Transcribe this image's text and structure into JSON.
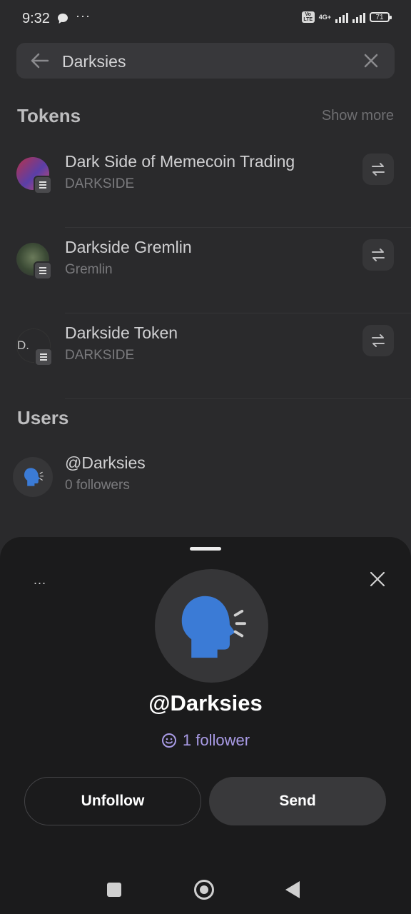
{
  "status_bar": {
    "time": "9:32",
    "network": "4G+",
    "volte": "Vo LTE",
    "battery": "71"
  },
  "search": {
    "value": "Darksies"
  },
  "tokens": {
    "title": "Tokens",
    "show_more": "Show more",
    "items": [
      {
        "name": "Dark Side of Memecoin Trading",
        "symbol": "DARKSIDE"
      },
      {
        "name": "Darkside Gremlin",
        "symbol": "Gremlin"
      },
      {
        "name": "Darkside Token",
        "symbol": "DARKSIDE",
        "avatar_text": "D."
      }
    ]
  },
  "users": {
    "title": "Users",
    "items": [
      {
        "name": "@Darksies",
        "followers": "0 followers"
      }
    ]
  },
  "sheet": {
    "more_label": "...",
    "username": "@Darksies",
    "followers": "1 follower",
    "unfollow_label": "Unfollow",
    "send_label": "Send"
  },
  "colors": {
    "background": "#2a2a2c",
    "sheet": "#1b1b1c",
    "accent_follower": "#a99be6",
    "avatar_blue": "#3b7bd6"
  },
  "icons": [
    "back-arrow-icon",
    "clear-icon",
    "swap-icon",
    "solana-icon",
    "speaking-head-icon",
    "close-icon",
    "smiley-icon"
  ]
}
